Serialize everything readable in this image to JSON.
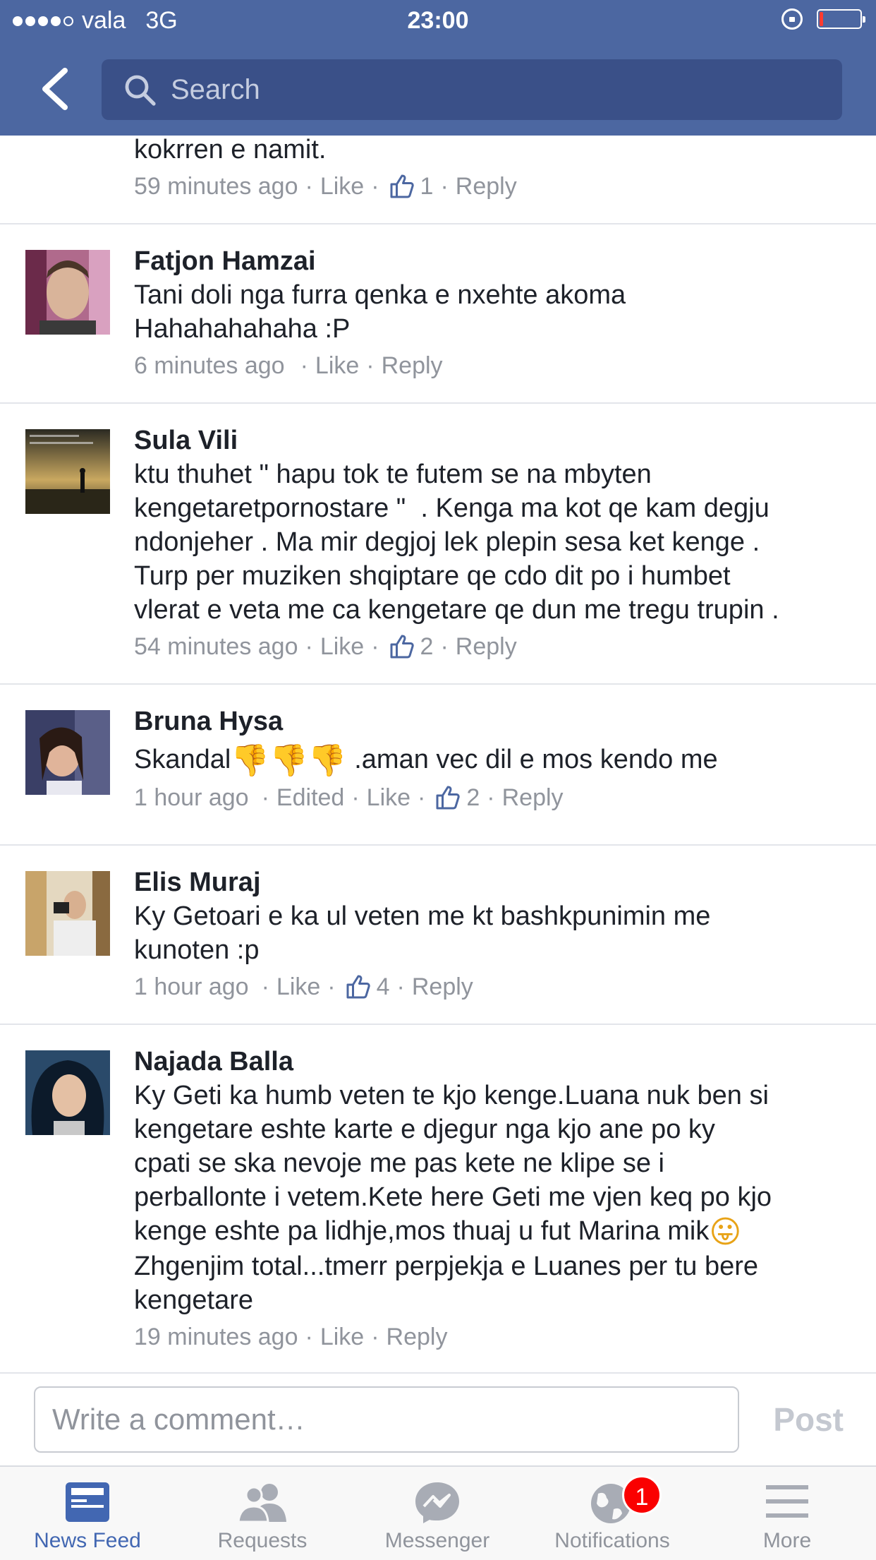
{
  "status_bar": {
    "carrier": "vala",
    "network": "3G",
    "time": "23:00"
  },
  "search": {
    "placeholder": "Search"
  },
  "comments": [
    {
      "name": "",
      "text": "kokrren e namit.",
      "time": "59 minutes ago",
      "like_label": "Like",
      "likes": "1",
      "reply_label": "Reply"
    },
    {
      "name": "Fatjon Hamzai",
      "text": "Tani doli nga furra qenka e nxehte akoma\nHahahahahaha :P",
      "time": "6 minutes ago",
      "like_label": "Like",
      "reply_label": "Reply"
    },
    {
      "name": "Sula Vili",
      "text": "ktu thuhet \" hapu tok te futem se na mbyten\nkengetaretpornostare \"  . Kenga ma kot qe kam degju\nndonjeher . Ma mir degjoj lek plepin sesa ket kenge .\nTurp per muziken shqiptare qe cdo dit po i humbet\nvlerat e veta me ca kengetare qe dun me tregu trupin .",
      "time": "54 minutes ago",
      "like_label": "Like",
      "likes": "2",
      "reply_label": "Reply"
    },
    {
      "name": "Bruna Hysa",
      "text_before": "Skandal",
      "text_after": " .aman vec dil e mos kendo me",
      "time": "1 hour ago",
      "edited_label": "Edited",
      "like_label": "Like",
      "likes": "2",
      "reply_label": "Reply"
    },
    {
      "name": "Elis Muraj",
      "text": "Ky Getoari e ka ul veten me kt bashkpunimin me\nkunoten :p",
      "time": "1 hour ago",
      "like_label": "Like",
      "likes": "4",
      "reply_label": "Reply"
    },
    {
      "name": "Najada Balla",
      "text_a": "Ky Geti ka humb veten te kjo kenge.Luana nuk ben si\nkengetare eshte karte e djegur nga kjo ane po ky\ncpati se ska nevoje me pas kete ne klipe se i\nperballonte i vetem.Kete here Geti me vjen keq po kjo\nkenge eshte pa lidhje,mos thuaj u fut Marina mik",
      "text_b": "Zhgenjim total...tmerr perpjekja e Luanes per tu bere\nkengetare",
      "time": "19 minutes ago",
      "like_label": "Like",
      "reply_label": "Reply"
    }
  ],
  "composer": {
    "placeholder": "Write a comment…",
    "post_label": "Post"
  },
  "tabs": [
    {
      "label": "News Feed",
      "icon": "news-feed-icon"
    },
    {
      "label": "Requests",
      "icon": "friend-requests-icon"
    },
    {
      "label": "Messenger",
      "icon": "messenger-icon"
    },
    {
      "label": "Notifications",
      "icon": "globe-icon",
      "badge": "1"
    },
    {
      "label": "More",
      "icon": "menu-icon"
    }
  ],
  "colors": {
    "brand": "#4c67a1",
    "active_tab": "#4267b2",
    "meta_text": "#90949c",
    "badge": "#fa0000"
  }
}
